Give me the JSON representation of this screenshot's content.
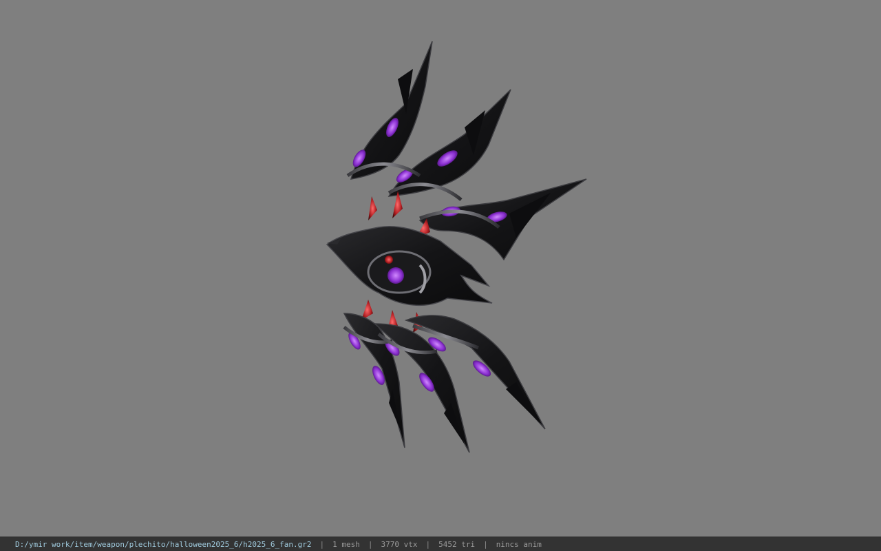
{
  "viewport": {
    "background": "#7f7f7f",
    "model_icon": "bat-wing-fan-model",
    "accent_colors": {
      "blade": "#1c1c1e",
      "trim": "#8a8a8e",
      "gem_purple": "#9b3fd6",
      "gem_red": "#c0282a"
    }
  },
  "status": {
    "path": "D:/ymir work/item/weapon/plechito/halloween2025_6/h2025_6_fan.gr2",
    "separator": "|",
    "mesh": "1 mesh",
    "vertices": "3770 vtx",
    "triangles": "5452 tri",
    "animation": "nincs anim"
  }
}
